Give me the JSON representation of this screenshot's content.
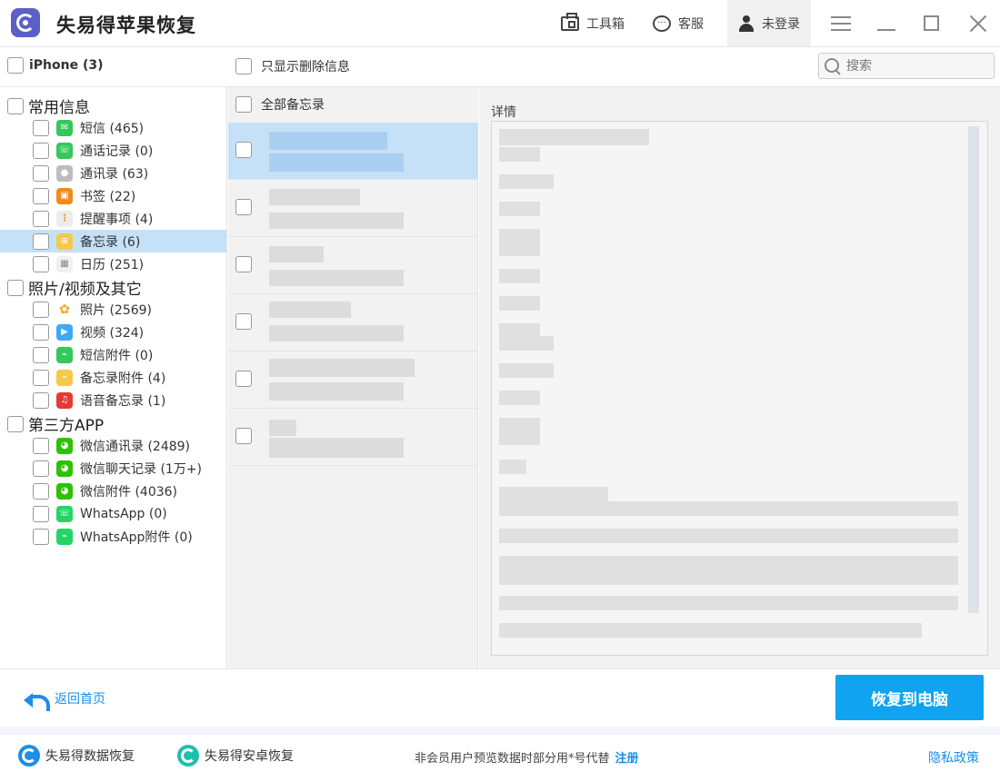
{
  "app": {
    "title": "失易得苹果恢复"
  },
  "titlebar": {
    "toolbox_label": "工具箱",
    "service_label": "客服",
    "login_label": "未登录"
  },
  "header": {
    "device_label": "iPhone (3)",
    "only_deleted_label": "只显示删除信息",
    "search_placeholder": "搜索"
  },
  "categories": [
    {
      "label": "常用信息",
      "items": [
        {
          "label": "短信 (465)",
          "icon": "sms-icon",
          "color": "#34c759"
        },
        {
          "label": "通话记录 (0)",
          "icon": "phone-icon",
          "color": "#34c759"
        },
        {
          "label": "通讯录 (63)",
          "icon": "contacts-icon",
          "color": "#b0b0b0"
        },
        {
          "label": "书签 (22)",
          "icon": "bookmark-icon",
          "color": "#f08a1c"
        },
        {
          "label": "提醒事项 (4)",
          "icon": "reminders-icon",
          "color": "#e8e8e8"
        },
        {
          "label": "备忘录 (6)",
          "icon": "notes-icon",
          "color": "#f7c948",
          "selected": true
        },
        {
          "label": "日历 (251)",
          "icon": "calendar-icon",
          "color": "#f2f2f2"
        }
      ]
    },
    {
      "label": "照片/视频及其它",
      "items": [
        {
          "label": "照片 (2569)",
          "icon": "photos-icon",
          "color": "#f5a623"
        },
        {
          "label": "视频 (324)",
          "icon": "video-icon",
          "color": "#3fa9f5"
        },
        {
          "label": "短信附件 (0)",
          "icon": "attachment-icon",
          "color": "#34c759"
        },
        {
          "label": "备忘录附件 (4)",
          "icon": "notes-attachment-icon",
          "color": "#f7c948"
        },
        {
          "label": "语音备忘录 (1)",
          "icon": "voice-memo-icon",
          "color": "#e53935"
        }
      ]
    },
    {
      "label": "第三方APP",
      "items": [
        {
          "label": "微信通讯录 (2489)",
          "icon": "wechat-contacts-icon",
          "color": "#2dc100"
        },
        {
          "label": "微信聊天记录 (1万+)",
          "icon": "wechat-chat-icon",
          "color": "#2dc100"
        },
        {
          "label": "微信附件 (4036)",
          "icon": "wechat-attachment-icon",
          "color": "#2dc100"
        },
        {
          "label": "WhatsApp (0)",
          "icon": "whatsapp-icon",
          "color": "#25d366"
        },
        {
          "label": "WhatsApp附件 (0)",
          "icon": "whatsapp-attachment-icon",
          "color": "#25d366"
        }
      ]
    }
  ],
  "middle": {
    "all_label": "全部备忘录"
  },
  "detail": {
    "label": "详情"
  },
  "actions": {
    "back_label": "返回首页",
    "recover_label": "恢复到电脑"
  },
  "footer": {
    "link1": "失易得数据恢复",
    "link2": "失易得安卓恢复",
    "notice": "非会员用户预览数据时部分用*号代替",
    "register": "注册",
    "privacy": "隐私政策"
  },
  "colors": {
    "accent": "#0fa3f0",
    "link": "#1a8ee8",
    "selection": "#c5e1f7"
  }
}
